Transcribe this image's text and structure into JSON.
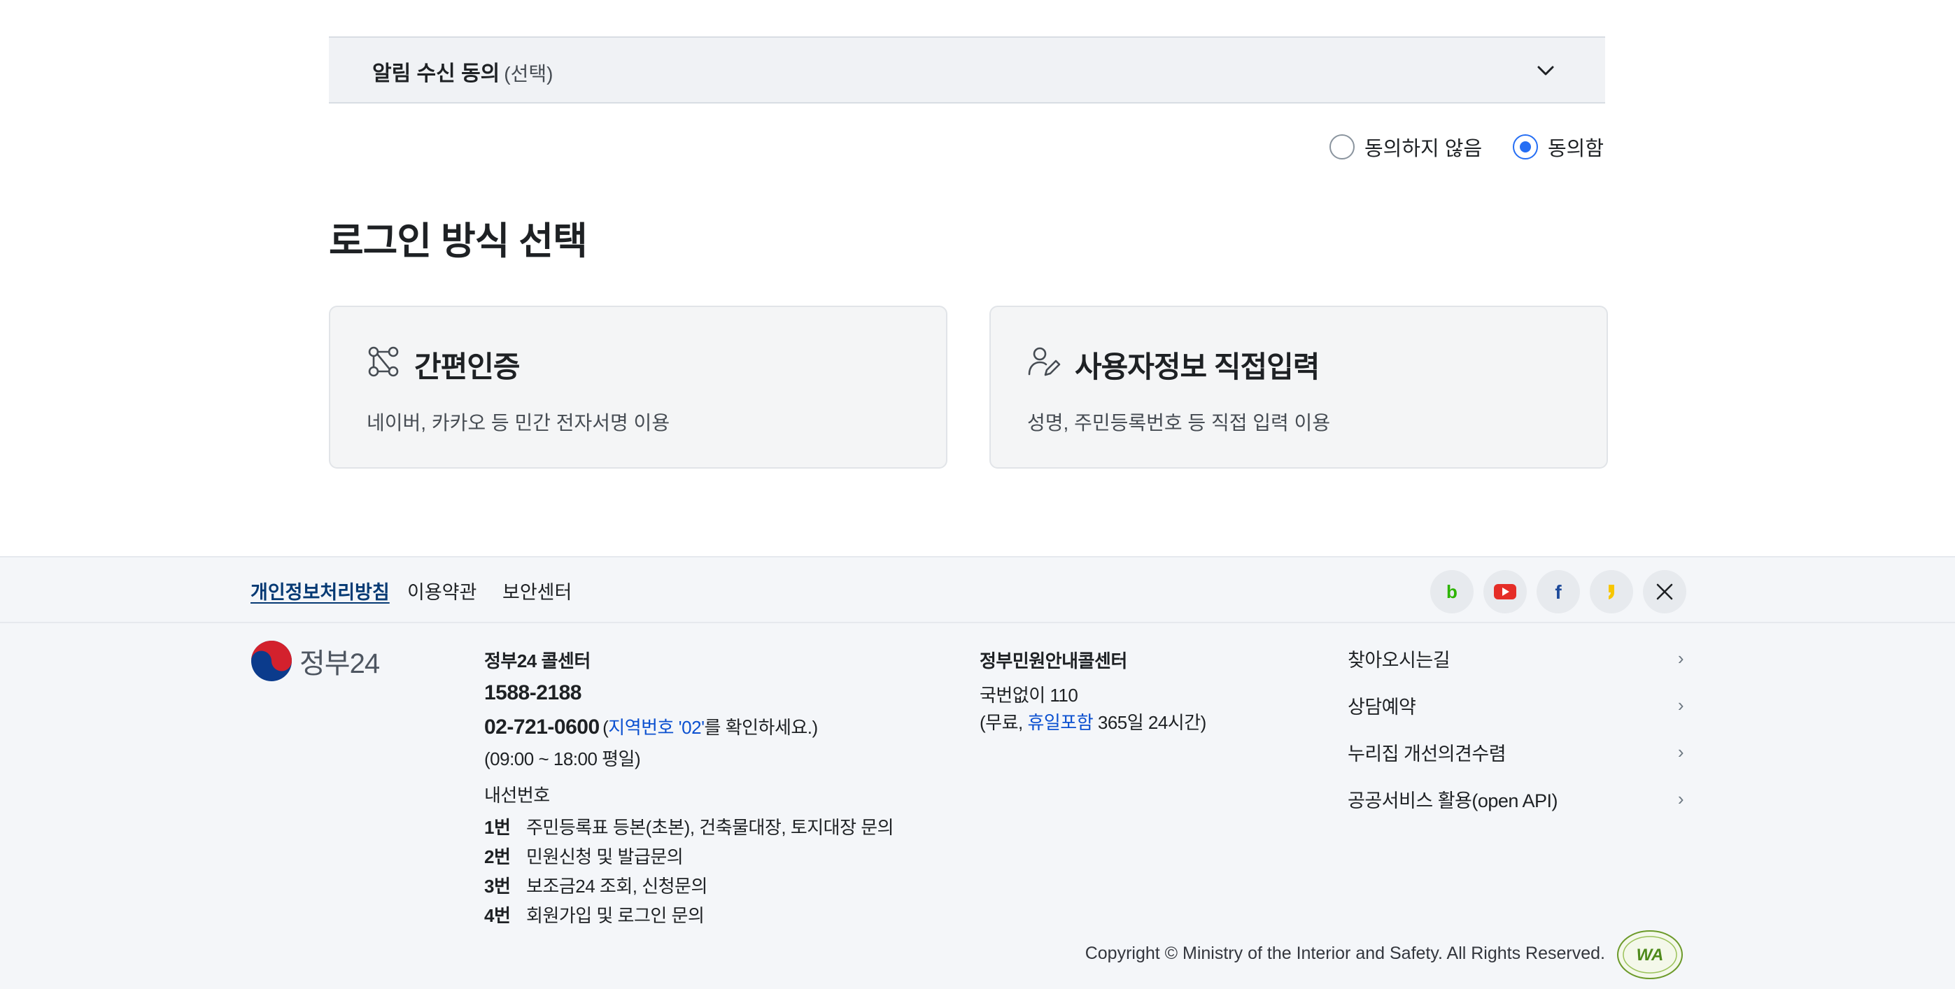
{
  "consent": {
    "title": "알림 수신 동의",
    "optional": "(선택)",
    "options": [
      {
        "label": "동의하지 않음",
        "checked": false
      },
      {
        "label": "동의함",
        "checked": true
      }
    ]
  },
  "login": {
    "title": "로그인 방식 선택",
    "cards": [
      {
        "title": "간편인증",
        "desc": "네이버, 카카오 등 민간 전자서명 이용",
        "icon": "simple-auth-icon"
      },
      {
        "title": "사용자정보 직접입력",
        "desc": "성명, 주민등록번호 등 직접 입력 이용",
        "icon": "user-edit-icon"
      }
    ]
  },
  "footer": {
    "links": [
      "개인정보처리방침",
      "이용약관",
      "보안센터"
    ],
    "sns": [
      "blog-icon",
      "youtube-icon",
      "facebook-icon",
      "kakao-story-icon",
      "x-icon"
    ],
    "logo_text": "정부24",
    "callcenter": {
      "title": "정부24 콜센터",
      "phone1": "1588-2188",
      "phone2": "02-721-0600",
      "phone2_note_open": "(",
      "phone2_note_blue": "지역번호 '02'",
      "phone2_note_rest": "를 확인하세요.)",
      "hours": "(09:00 ~ 18:00 평일)",
      "ext_title": "내선번호",
      "extensions": [
        {
          "num": "1번",
          "text": "주민등록표 등본(초본), 건축물대장, 토지대장 문의"
        },
        {
          "num": "2번",
          "text": "민원신청 및 발급문의"
        },
        {
          "num": "3번",
          "text": "보조금24 조회, 신청문의"
        },
        {
          "num": "4번",
          "text": "회원가입 및 로그인 문의"
        }
      ]
    },
    "gov": {
      "title": "정부민원안내콜센터",
      "phone": "국번없이 110",
      "note_open": "(무료, ",
      "note_blue": "휴일포함",
      "note_rest": " 365일 24시간)"
    },
    "quicklinks": [
      "찾아오시는길",
      "상담예약",
      "누리집 개선의견수렴",
      "공공서비스 활용(open API)"
    ],
    "copyright": "Copyright © Ministry of the Interior and Safety. All Rights Reserved.",
    "wa_mark": "WA"
  },
  "colors": {
    "accent": "#256ef4",
    "link": "#063a74",
    "highlight": "#0b50d0",
    "bg_footer": "#f4f6f9"
  }
}
